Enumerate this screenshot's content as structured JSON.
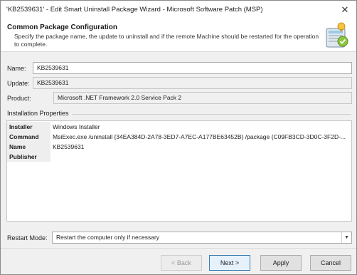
{
  "window": {
    "title": "'KB2539631' - Edit Smart Uninstall Package Wizard - Microsoft Software Patch (MSP)",
    "close_glyph": "✕"
  },
  "header": {
    "title": "Common Package Configuration",
    "description": "Specify the package name, the update to uninstall and if the remote Machine should be restarted for the operation to complete.",
    "icon": "package-config-icon"
  },
  "fields": {
    "name_label": "Name:",
    "name_value": "KB2539631",
    "update_label": "Update:",
    "update_value": "KB2539631",
    "product_label": "Product:",
    "product_value": "Microsoft .NET Framework 2.0 Service Pack 2"
  },
  "installation": {
    "section_label": "Installation Properties",
    "rows": [
      {
        "key": "Installer",
        "value": "Windows Installer"
      },
      {
        "key": "Command",
        "value": "MsiExec.exe /uninstall {34EA384D-2A78-3ED7-A7EC-A177BE63452B} /package {C09FB3CD-3D0C-3F2D-..."
      },
      {
        "key": "Name",
        "value": "KB2539631"
      },
      {
        "key": "Publisher",
        "value": ""
      }
    ]
  },
  "restart": {
    "label": "Restart Mode:",
    "selected": "Restart the computer only if necessary"
  },
  "buttons": {
    "back": "< Back",
    "next": "Next >",
    "apply": "Apply",
    "cancel": "Cancel"
  },
  "colors": {
    "accent": "#3c7fb1",
    "window_bg": "#f0f0f0"
  }
}
